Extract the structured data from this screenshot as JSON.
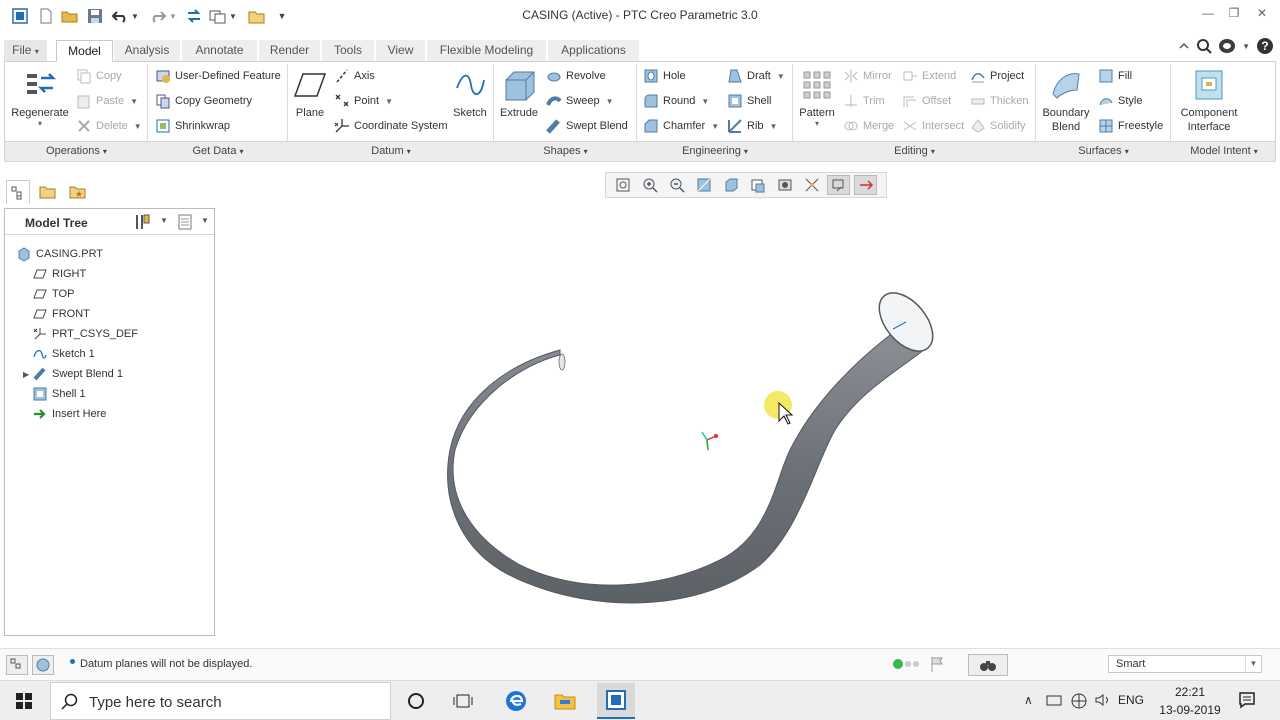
{
  "window": {
    "title": "CASING (Active) - PTC Creo Parametric 3.0"
  },
  "tabs": [
    {
      "label": "File"
    },
    {
      "label": "Model"
    },
    {
      "label": "Analysis"
    },
    {
      "label": "Annotate"
    },
    {
      "label": "Render"
    },
    {
      "label": "Tools"
    },
    {
      "label": "View"
    },
    {
      "label": "Flexible Modeling"
    },
    {
      "label": "Applications"
    }
  ],
  "ribbon": {
    "operations": {
      "regenerate": "Regenerate",
      "copy": "Copy",
      "paste": "Paste",
      "delete": "Delete"
    },
    "getdata": {
      "udf": "User-Defined Feature",
      "copygeom": "Copy Geometry",
      "shrinkwrap": "Shrinkwrap"
    },
    "datum": {
      "plane": "Plane",
      "axis": "Axis",
      "point": "Point",
      "csys": "Coordinate System",
      "sketch": "Sketch"
    },
    "shapes": {
      "extrude": "Extrude",
      "revolve": "Revolve",
      "sweep": "Sweep",
      "swept_blend": "Swept Blend"
    },
    "engineering": {
      "hole": "Hole",
      "round": "Round",
      "chamfer": "Chamfer",
      "draft": "Draft",
      "shell": "Shell",
      "rib": "Rib"
    },
    "editing": {
      "pattern": "Pattern",
      "mirror": "Mirror",
      "trim": "Trim",
      "merge": "Merge",
      "extend": "Extend",
      "offset": "Offset",
      "intersect": "Intersect",
      "project": "Project",
      "thicken": "Thicken",
      "solidify": "Solidify"
    },
    "surfaces": {
      "boundary_blend_1": "Boundary",
      "boundary_blend_2": "Blend",
      "fill": "Fill",
      "style": "Style",
      "freestyle": "Freestyle"
    },
    "model_intent": {
      "component_interface_1": "Component",
      "component_interface_2": "Interface"
    },
    "groups": [
      "Operations",
      "Get Data",
      "Datum",
      "Shapes",
      "Engineering",
      "Editing",
      "Surfaces",
      "Model Intent"
    ]
  },
  "model_tree": {
    "title": "Model Tree",
    "items": [
      {
        "label": "CASING.PRT",
        "icon": "part-icon"
      },
      {
        "label": "RIGHT",
        "icon": "datum-plane-icon"
      },
      {
        "label": "TOP",
        "icon": "datum-plane-icon"
      },
      {
        "label": "FRONT",
        "icon": "datum-plane-icon"
      },
      {
        "label": "PRT_CSYS_DEF",
        "icon": "csys-icon"
      },
      {
        "label": "Sketch 1",
        "icon": "sketch-icon"
      },
      {
        "label": "Swept Blend 1",
        "icon": "swept-blend-icon",
        "expandable": true
      },
      {
        "label": "Shell 1",
        "icon": "shell-icon"
      },
      {
        "label": "Insert Here",
        "icon": "insert-arrow-icon"
      }
    ]
  },
  "status": {
    "message": "Datum planes will not be displayed.",
    "filter": "Smart"
  },
  "taskbar": {
    "search_placeholder": "Type here to search",
    "lang": "ENG",
    "time": "22:21",
    "date": "13-09-2019"
  },
  "colors": {
    "accent": "#1f6fb5",
    "part": "#6e7379",
    "highlight": "#f0e020"
  }
}
